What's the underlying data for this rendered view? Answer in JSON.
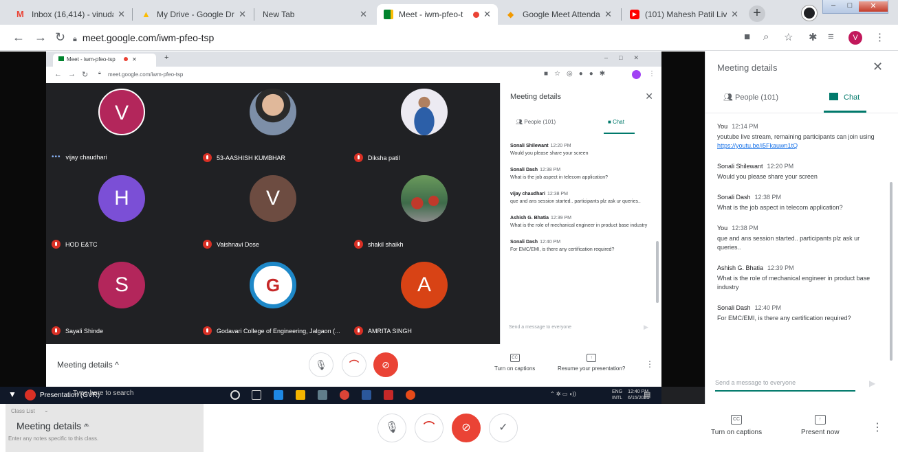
{
  "browser": {
    "tabs": [
      {
        "title": "Inbox (16,414) - vinuda",
        "icon_color": "#ea4335",
        "fav": "M"
      },
      {
        "title": "My Drive - Google Driv",
        "icon_color": "#fbbc04",
        "fav": "▲"
      },
      {
        "title": "New Tab",
        "icon_color": "",
        "fav": ""
      },
      {
        "title": "Meet - iwm-pfeo-t",
        "icon_color": "#00832d",
        "fav": "■"
      },
      {
        "title": "Google Meet Attendan",
        "icon_color": "#f29900",
        "fav": "◆"
      },
      {
        "title": "(101) Mahesh Patil Live",
        "icon_color": "#ff0000",
        "fav": "▶"
      }
    ],
    "url": "meet.google.com/iwm-pfeo-tsp",
    "profile_initial": "V"
  },
  "inner_browser": {
    "tab_title": "Meet - iwm-pfeo-tsp",
    "url": "meet.google.com/iwm-pfeo-tsp"
  },
  "participants": [
    {
      "name": "vijay chaudhari",
      "initial": "V",
      "color": "#b3265b",
      "speaking": true
    },
    {
      "name": "53-AASHISH KUMBHAR",
      "initial": "",
      "color": "#6b7a8f",
      "photo": true
    },
    {
      "name": "Diksha patil",
      "initial": "",
      "color": "#e8e8f0",
      "photo": true
    },
    {
      "name": "HOD E&TC",
      "initial": "H",
      "color": "#7b4fd6"
    },
    {
      "name": "Vaishnavi Dose",
      "initial": "V",
      "color": "#6d4c41"
    },
    {
      "name": "shakil shaikh",
      "initial": "",
      "color": "#3e6b4a",
      "photo": true
    },
    {
      "name": "Sayali Shinde",
      "initial": "S",
      "color": "#b3265b"
    },
    {
      "name": "Godavari College of Engineering, Jalgaon (...",
      "initial": "G",
      "color": "#ffffff",
      "logo": true
    },
    {
      "name": "AMRITA SINGH",
      "initial": "A",
      "color": "#d84315"
    }
  ],
  "inner_panel": {
    "title": "Meeting details",
    "people_tab": "People (101)",
    "chat_tab": "Chat",
    "messages": [
      {
        "sender": "Sonali Shilewant",
        "time": "12:20 PM",
        "text": "Would you please share your screen"
      },
      {
        "sender": "Sonali Dash",
        "time": "12:38 PM",
        "text": "What is the job aspect in telecom application?"
      },
      {
        "sender": "vijay chaudhari",
        "time": "12:38 PM",
        "text": "que and ans session started.. participants plz ask ur queries.."
      },
      {
        "sender": "Ashish G. Bhatia",
        "time": "12:39 PM",
        "text": "What is the role of mechanical engineer in product base industry"
      },
      {
        "sender": "Sonali Dash",
        "time": "12:40 PM",
        "text": "For EMC/EMI, is there any certification required?"
      }
    ],
    "input_placeholder": "Send a message to everyone"
  },
  "inner_bar": {
    "meeting_details": "Meeting details",
    "captions": "Turn on captions",
    "present": "Resume your presentation?"
  },
  "taskbar": {
    "presenting": "Presentation (GVR)",
    "search": "Type here to search",
    "lang": "ENG",
    "lang2": "INTL",
    "time": "12:40 PM",
    "date": "6/15/2021"
  },
  "ghost": {
    "class_list": "Class List",
    "notes": "Enter any notes specific to this class."
  },
  "outer_bar": {
    "meeting_details": "Meeting details",
    "captions": "Turn on captions",
    "present": "Present now"
  },
  "outer_panel": {
    "title": "Meeting details",
    "people_tab": "People (101)",
    "chat_tab": "Chat",
    "messages": [
      {
        "sender": "You",
        "time": "12:14 PM",
        "text": "youtube live stream, remaining participants can join using",
        "link": "https://youtu.be/i5Fkauwn1tQ"
      },
      {
        "sender": "Sonali Shilewant",
        "time": "12:20 PM",
        "text": "Would you please share your screen",
        "link": ""
      },
      {
        "sender": "Sonali Dash",
        "time": "12:38 PM",
        "text": "What is the job aspect in telecom application?",
        "link": ""
      },
      {
        "sender": "You",
        "time": "12:38 PM",
        "text": "que and ans session started.. participants plz ask ur queries..",
        "link": ""
      },
      {
        "sender": "Ashish G. Bhatia",
        "time": "12:39 PM",
        "text": "What is the role of mechanical engineer in product base industry",
        "link": ""
      },
      {
        "sender": "Sonali Dash",
        "time": "12:40 PM",
        "text": "For EMC/EMI, is there any certification required?",
        "link": ""
      }
    ],
    "input_placeholder": "Send a message to everyone"
  }
}
